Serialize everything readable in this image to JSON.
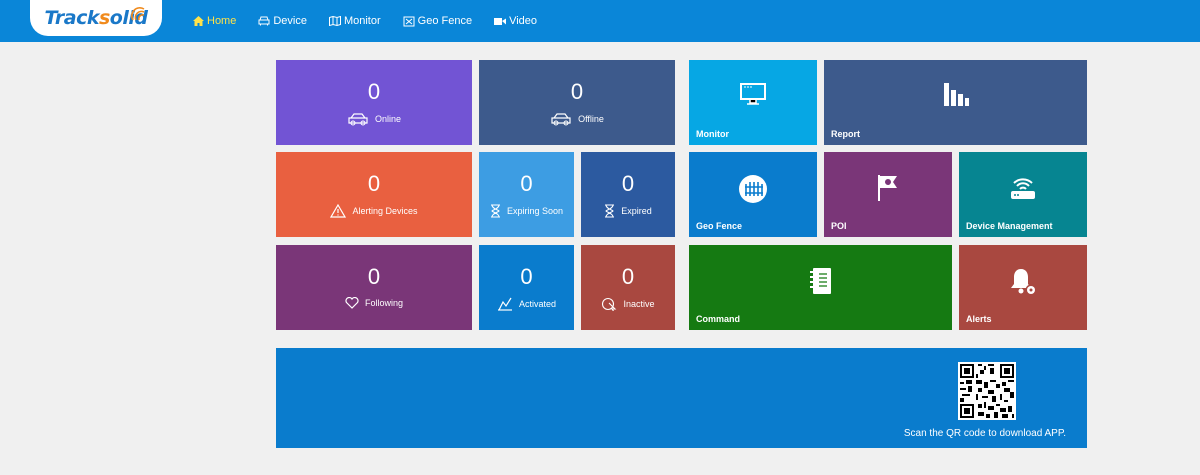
{
  "header": {
    "logo_text": "Tracksolid",
    "nav": [
      {
        "label": "Home",
        "active": true
      },
      {
        "label": "Device"
      },
      {
        "label": "Monitor"
      },
      {
        "label": "Geo Fence"
      },
      {
        "label": "Video"
      }
    ]
  },
  "stats": {
    "online": {
      "value": "0",
      "label": "Online",
      "color": "#7254d4"
    },
    "offline": {
      "value": "0",
      "label": "Offline",
      "color": "#3d5a8c"
    },
    "alerting": {
      "value": "0",
      "label": "Alerting Devices",
      "color": "#e96040"
    },
    "expiring_soon": {
      "value": "0",
      "label": "Expiring Soon",
      "color": "#3d9de3"
    },
    "expired": {
      "value": "0",
      "label": "Expired",
      "color": "#2c5aa0"
    },
    "following": {
      "value": "0",
      "label": "Following",
      "color": "#7a3678"
    },
    "activated": {
      "value": "0",
      "label": "Activated",
      "color": "#0a7ccd"
    },
    "inactive": {
      "value": "0",
      "label": "Inactive",
      "color": "#a94840"
    }
  },
  "modules": {
    "monitor": {
      "label": "Monitor",
      "color": "#06a7e4"
    },
    "report": {
      "label": "Report",
      "color": "#3d5a8c"
    },
    "geo_fence": {
      "label": "Geo Fence",
      "color": "#0a7ccd"
    },
    "poi": {
      "label": "POI",
      "color": "#7a3678"
    },
    "device_management": {
      "label": "Device Management",
      "color": "#068591"
    },
    "command": {
      "label": "Command",
      "color": "#157a12"
    },
    "alerts": {
      "label": "Alerts",
      "color": "#a94840"
    }
  },
  "banner": {
    "qr_caption": "Scan the QR code to download APP."
  }
}
